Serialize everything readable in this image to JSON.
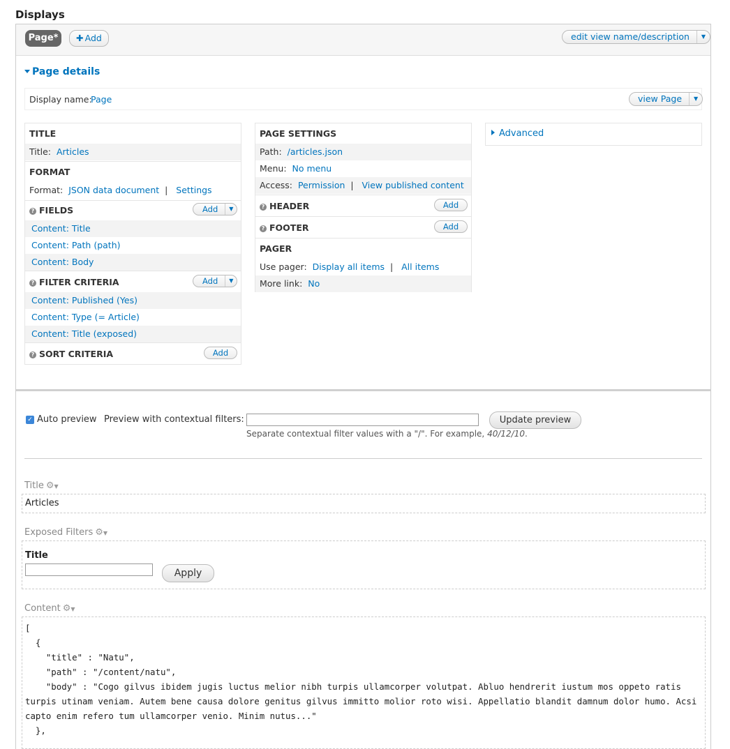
{
  "heading": "Displays",
  "tabs": {
    "active": "Page*",
    "add": "Add"
  },
  "edit_name": "edit view name/description",
  "page_details": "Page details",
  "display_name": {
    "label": "Display name:",
    "value": "Page"
  },
  "view_page": "view Page",
  "col1": {
    "title": {
      "heading": "TITLE",
      "label": "Title:",
      "value": "Articles"
    },
    "format": {
      "heading": "FORMAT",
      "label": "Format:",
      "value": "JSON data document",
      "sep": "|",
      "settings": "Settings"
    },
    "fields": {
      "heading": "FIELDS",
      "add": "Add",
      "items": [
        "Content: Title",
        "Content: Path (path)",
        "Content: Body"
      ]
    },
    "filters": {
      "heading": "FILTER CRITERIA",
      "add": "Add",
      "items": [
        "Content: Published (Yes)",
        "Content: Type (= Article)",
        "Content: Title (exposed)"
      ]
    },
    "sort": {
      "heading": "SORT CRITERIA",
      "add": "Add"
    }
  },
  "col2": {
    "page_settings": {
      "heading": "PAGE SETTINGS",
      "path_label": "Path:",
      "path_value": "/articles.json",
      "menu_label": "Menu:",
      "menu_value": "No menu",
      "access_label": "Access:",
      "access_value": "Permission",
      "access_sep": "|",
      "access_value2": "View published content"
    },
    "header": {
      "heading": "HEADER",
      "add": "Add"
    },
    "footer": {
      "heading": "FOOTER",
      "add": "Add"
    },
    "pager": {
      "heading": "PAGER",
      "use_label": "Use pager:",
      "use_value": "Display all items",
      "use_sep": "|",
      "use_value2": "All items",
      "more_label": "More link:",
      "more_value": "No"
    }
  },
  "col3": {
    "advanced": "Advanced"
  },
  "preview": {
    "auto_preview": "Auto preview",
    "auto_checked": true,
    "ctx_label": "Preview with contextual filters:",
    "ctx_value": "",
    "update_button": "Update preview",
    "hint": "Separate contextual filter values with a \"/\". For example, ",
    "hint_example": "40/12/10",
    "hint_end": "."
  },
  "areas": {
    "title_label": "Title",
    "title_value": "Articles",
    "exposed_label": "Exposed Filters",
    "exposed_field_label": "Title",
    "exposed_field_value": "",
    "apply_button": "Apply",
    "content_label": "Content",
    "content_code": "[\n  {\n    \"title\" : \"Natu\",\n    \"path\" : \"/content/natu\",\n    \"body\" : \"Cogo gilvus ibidem jugis luctus melior nibh turpis ullamcorper volutpat. Abluo hendrerit iustum mos oppeto ratis turpis utinam veniam. Autem bene causa dolore genitus gilvus immitto molior roto wisi. Appellatio blandit damnum dolor humo. Acsi capto enim refero tum ullamcorper venio. Minim nutus...\"\n  },"
  },
  "icons": {
    "caret": "chevron-down-icon",
    "help": "question-icon",
    "gear": "gear-icon",
    "triangle_right": "triangle-right-icon",
    "triangle_down": "triangle-down-icon"
  },
  "colors": {
    "link": "#0074bd",
    "tab_active": "#666666",
    "checkbox": "#3b86d8"
  }
}
